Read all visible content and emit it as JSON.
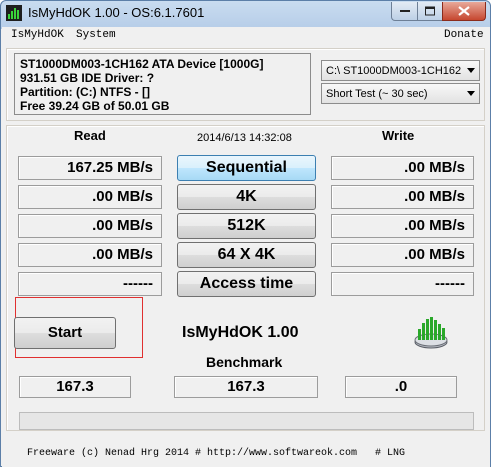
{
  "window": {
    "title": "IsMyHdOK 1.00 - OS:6.1.7601"
  },
  "menu": {
    "items": [
      "IsMyHdOK",
      "System"
    ],
    "donate": "Donate"
  },
  "drive_info": {
    "lines": [
      "ST1000DM003-1CH162 ATA Device [1000G]",
      "931.51 GB  IDE Driver: ?",
      "Partition: (C:) NTFS - []",
      "Free 39.24 GB of 50.01 GB"
    ]
  },
  "selects": {
    "drive": "C:\\ ST1000DM003-1CH162",
    "test_mode": "Short Test (~ 30 sec)"
  },
  "columns": {
    "read": "Read",
    "write": "Write"
  },
  "datetime": "2014/6/13 14:32:08",
  "tests": [
    {
      "label": "Sequential",
      "read": "167.25 MB/s",
      "write": ".00 MB/s"
    },
    {
      "label": "4K",
      "read": ".00 MB/s",
      "write": ".00 MB/s"
    },
    {
      "label": "512K",
      "read": ".00 MB/s",
      "write": ".00 MB/s"
    },
    {
      "label": "64 X 4K",
      "read": ".00 MB/s",
      "write": ".00 MB/s"
    },
    {
      "label": "Access time",
      "read": "------",
      "write": "------"
    }
  ],
  "start_label": "Start",
  "app_name": "IsMyHdOK 1.00",
  "benchmark": {
    "label": "Benchmark",
    "values": [
      "167.3",
      "167.3",
      ".0"
    ]
  },
  "footer": "Freeware (c) Nenad Hrg 2014 # http://www.softwareok.com   # LNG",
  "colors": {
    "active_button": "#bee6fd",
    "highlight": "#e03030",
    "logo_green": "#2aa82a"
  }
}
